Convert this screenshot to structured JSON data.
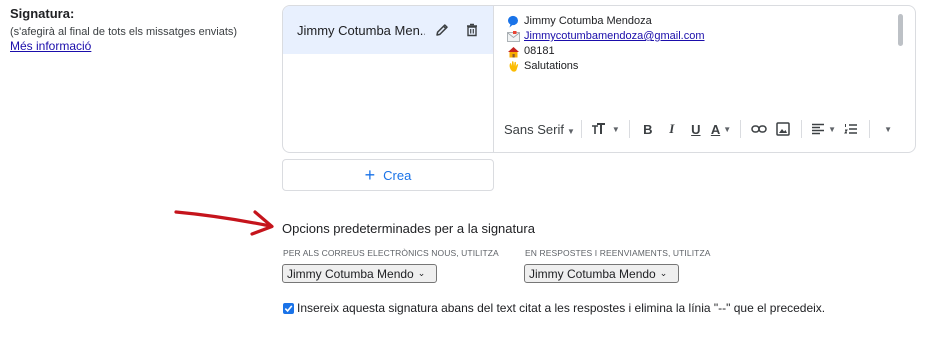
{
  "left": {
    "title": "Signatura:",
    "subtitle": "(s'afegirà al final de tots els missatges enviats)",
    "link": "Més informació"
  },
  "signatures": {
    "items": [
      {
        "label": "Jimmy Cotumba Men..."
      }
    ]
  },
  "editor": {
    "lines": [
      {
        "icon": "speech-bubble-icon",
        "text": "Jimmy Cotumba Mendoza"
      },
      {
        "icon": "envelope-icon",
        "text": "Jimmycotumbamendoza@gmail.com"
      },
      {
        "icon": "house-icon",
        "text": "08181"
      },
      {
        "icon": "waving-hand-icon",
        "text": "Salutations"
      }
    ],
    "toolbar": {
      "font": "Sans Serif",
      "size_icon": "text-size-icon",
      "bold": "B",
      "italic": "I",
      "underline": "U",
      "text_color": "A",
      "link_icon": "link-icon",
      "image_icon": "image-icon",
      "align_icon": "align-icon",
      "list_icon": "numbered-list-icon",
      "more_icon": "more-formatting-icon"
    }
  },
  "create_button": {
    "label": "Crea"
  },
  "defaults": {
    "title": "Opcions predeterminades per a la signatura",
    "new_label": "PER ALS CORREUS ELECTRÒNICS NOUS, UTILITZA",
    "new_value": "Jimmy Cotumba Mendo",
    "reply_label": "EN RESPOSTES I REENVIAMENTS, UTILITZA",
    "reply_value": "Jimmy Cotumba Mendo",
    "checkbox_label": "Insereix aquesta signatura abans del text citat a les respostes i elimina la línia \"--\" que el precedeix.",
    "checkbox_checked": true
  },
  "colors": {
    "accent": "#1a73e8",
    "arrow": "#c5141c",
    "selected_bg": "#e8f0fe",
    "link": "#1a0dab"
  }
}
